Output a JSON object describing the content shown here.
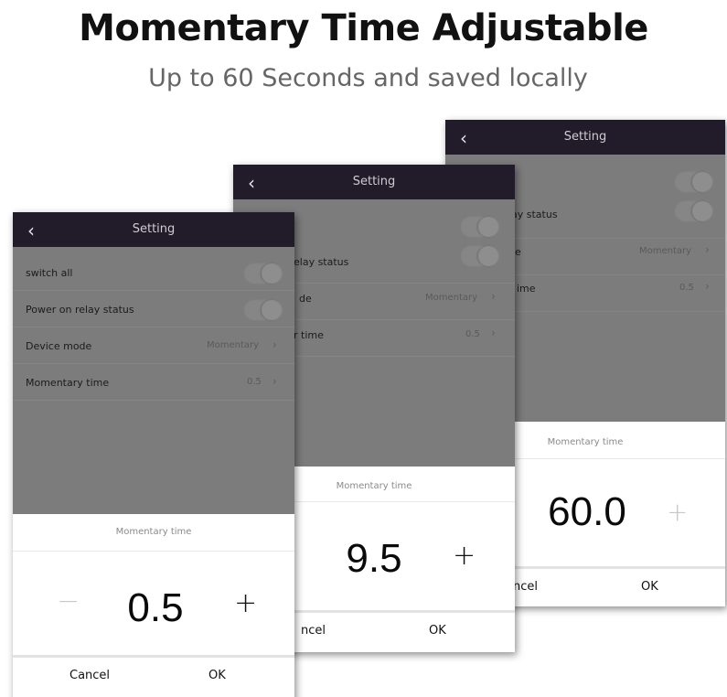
{
  "headline": "Momentary Time Adjustable",
  "subheadline": "Up to 60 Seconds and  saved locally",
  "screens": [
    {
      "header_title": "Setting",
      "back_icon": "‹",
      "rows": [
        {
          "label": "switch all",
          "toggle": "off"
        },
        {
          "label": "Power on relay status",
          "toggle": "off"
        },
        {
          "label": "Device mode",
          "value": "Momentary"
        },
        {
          "label": "Momentary time",
          "value": "0.5"
        }
      ],
      "dialog": {
        "title": "Momentary time",
        "value": "0.5",
        "minus": "−",
        "plus": "+",
        "cancel": "Cancel",
        "ok": "OK"
      }
    },
    {
      "header_title": "Setting",
      "back_icon": "‹",
      "rows": [
        {
          "label": "elay status",
          "toggle": "off"
        },
        {
          "label": "de",
          "value": "Momentary"
        },
        {
          "label": "r time",
          "value": "0.5"
        }
      ],
      "dialog": {
        "title": "Momentary time",
        "value": "9.5",
        "plus": "+",
        "cancel": "ncel",
        "ok": "OK"
      }
    },
    {
      "header_title": "Setting",
      "back_icon": "‹",
      "rows": [
        {
          "label": "ay status",
          "toggle": "off"
        },
        {
          "label": "e",
          "value": "Momentary"
        },
        {
          "label": "ime",
          "value": "0.5"
        }
      ],
      "dialog": {
        "title": "Momentary time",
        "value": "60.0",
        "plus": "+",
        "cancel": "ncel",
        "ok": "OK"
      }
    }
  ],
  "chevron": "›",
  "colors": {
    "header": "#221b2a",
    "overlay": "#7c7c7c",
    "dialog": "#ffffff",
    "plus_disabled": "#c8c8c8"
  }
}
